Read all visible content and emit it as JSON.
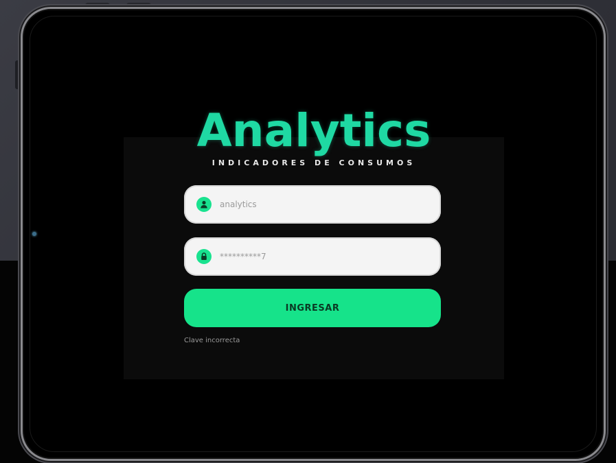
{
  "brand": {
    "title": "Analytics",
    "subtitle": "INDICADORES DE CONSUMOS"
  },
  "form": {
    "username_value": "analytics",
    "password_value": "**********7",
    "submit_label": "INGRESAR",
    "forgot_label": "Clave incorrecta"
  },
  "icons": {
    "username": "user-icon",
    "password": "lock-icon"
  },
  "colors": {
    "accent": "#1fd9a3",
    "button": "#16e38a",
    "background": "#000000"
  }
}
